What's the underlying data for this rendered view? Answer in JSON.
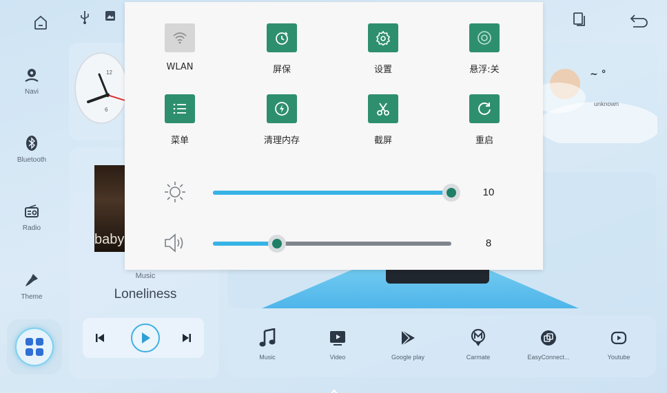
{
  "quick_settings": {
    "tiles": [
      {
        "label": "WLAN",
        "icon": "wifi-icon",
        "active": false
      },
      {
        "label": "屏保",
        "icon": "screensaver-timer-icon",
        "active": true
      },
      {
        "label": "设置",
        "icon": "gear-icon",
        "active": true
      },
      {
        "label": "悬浮:关",
        "icon": "floating-button-icon",
        "active": true
      },
      {
        "label": "菜单",
        "icon": "menu-list-icon",
        "active": true
      },
      {
        "label": "清理内存",
        "icon": "clean-memory-icon",
        "active": true
      },
      {
        "label": "截屏",
        "icon": "scissors-icon",
        "active": true
      },
      {
        "label": "重启",
        "icon": "restart-icon",
        "active": true
      }
    ],
    "brightness": {
      "value": "10",
      "fraction": 1.0,
      "icon": "brightness-icon"
    },
    "volume": {
      "value": "8",
      "fraction": 0.27,
      "icon": "speaker-icon"
    },
    "accent_color": "#2e8f6f",
    "slider_color": "#37b3e6"
  },
  "sidebar": {
    "items": [
      {
        "label": "Navi",
        "icon": "navigation-pin-icon"
      },
      {
        "label": "Bluetooth",
        "icon": "bluetooth-icon"
      },
      {
        "label": "Radio",
        "icon": "radio-icon"
      },
      {
        "label": "Theme",
        "icon": "paintbrush-icon"
      }
    ],
    "apps_icon": "app-grid-icon"
  },
  "music": {
    "source_label": "Music",
    "track_title": "Loneliness",
    "album_art_text": "baby"
  },
  "clock": {
    "numerals": [
      "12",
      "6"
    ]
  },
  "weather": {
    "temperature": "~ °",
    "status": "unknown"
  },
  "dock": {
    "items": [
      {
        "label": "Music",
        "icon": "music-note-icon"
      },
      {
        "label": "Video",
        "icon": "video-icon"
      },
      {
        "label": "Google play",
        "icon": "play-store-icon"
      },
      {
        "label": "Carmate",
        "icon": "carmate-icon"
      },
      {
        "label": "EasyConnect...",
        "icon": "easyconnect-icon"
      },
      {
        "label": "Youtube",
        "icon": "youtube-icon"
      }
    ]
  }
}
